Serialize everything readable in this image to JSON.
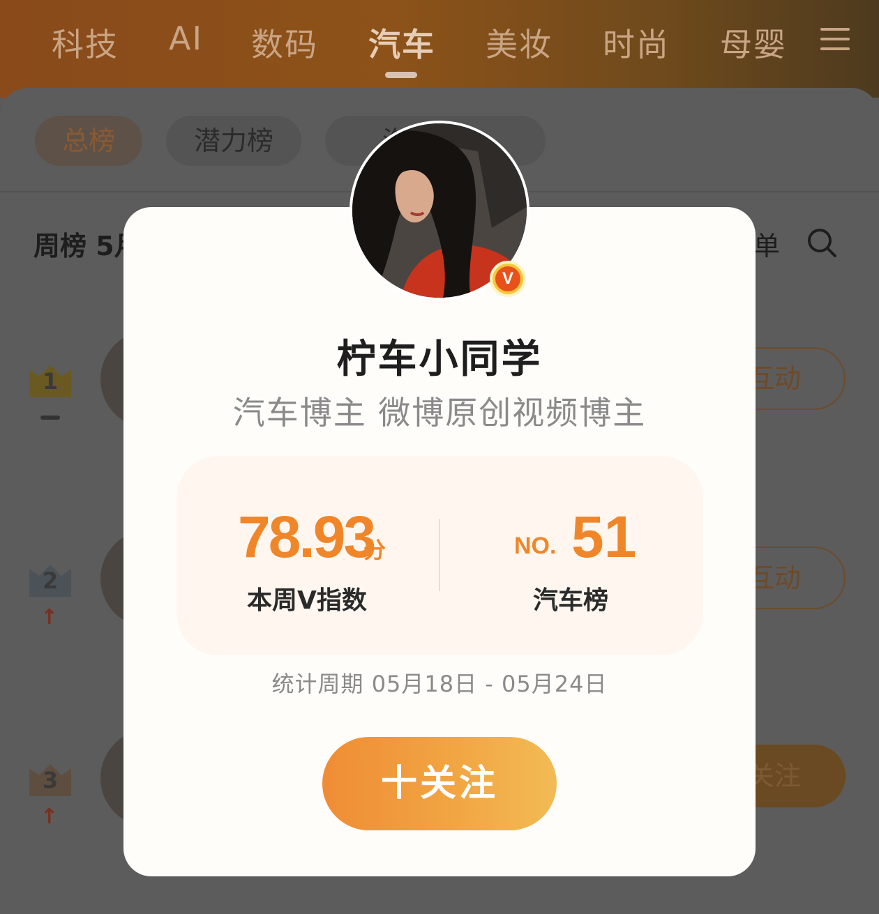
{
  "top_tabs": {
    "items": [
      {
        "label": "科技"
      },
      {
        "label": "AI"
      },
      {
        "label": "数码"
      },
      {
        "label": "汽车"
      },
      {
        "label": "美妆"
      },
      {
        "label": "时尚"
      },
      {
        "label": "母婴"
      }
    ],
    "active": "汽车"
  },
  "filter_chips": {
    "items": [
      {
        "label": "总榜"
      },
      {
        "label": "潜力榜"
      },
      {
        "label": "汽车博主"
      }
    ],
    "active": "总榜"
  },
  "list_header": {
    "week_label": "周榜 5月",
    "right_fragment": "单"
  },
  "ranking_rows": [
    {
      "rank": "1",
      "action": "互动"
    },
    {
      "rank": "2",
      "action": "互动"
    },
    {
      "rank": "3",
      "action": "关注"
    }
  ],
  "modal": {
    "name": "柠车小同学",
    "description": "汽车博主 微博原创视频博主",
    "verified_badge": "V",
    "score_value": "78.93",
    "score_unit": "分",
    "score_label": "本周V指数",
    "rank_prefix": "NO.",
    "rank_value": "51",
    "rank_label": "汽车榜",
    "period": "统计周期 05月18日 - 05月24日",
    "follow_label": "十关注"
  },
  "colors": {
    "accent": "#f0862a",
    "follow_gradient_start": "#ef8c35",
    "follow_gradient_end": "#f2bb55",
    "badge": "#e8521a"
  }
}
